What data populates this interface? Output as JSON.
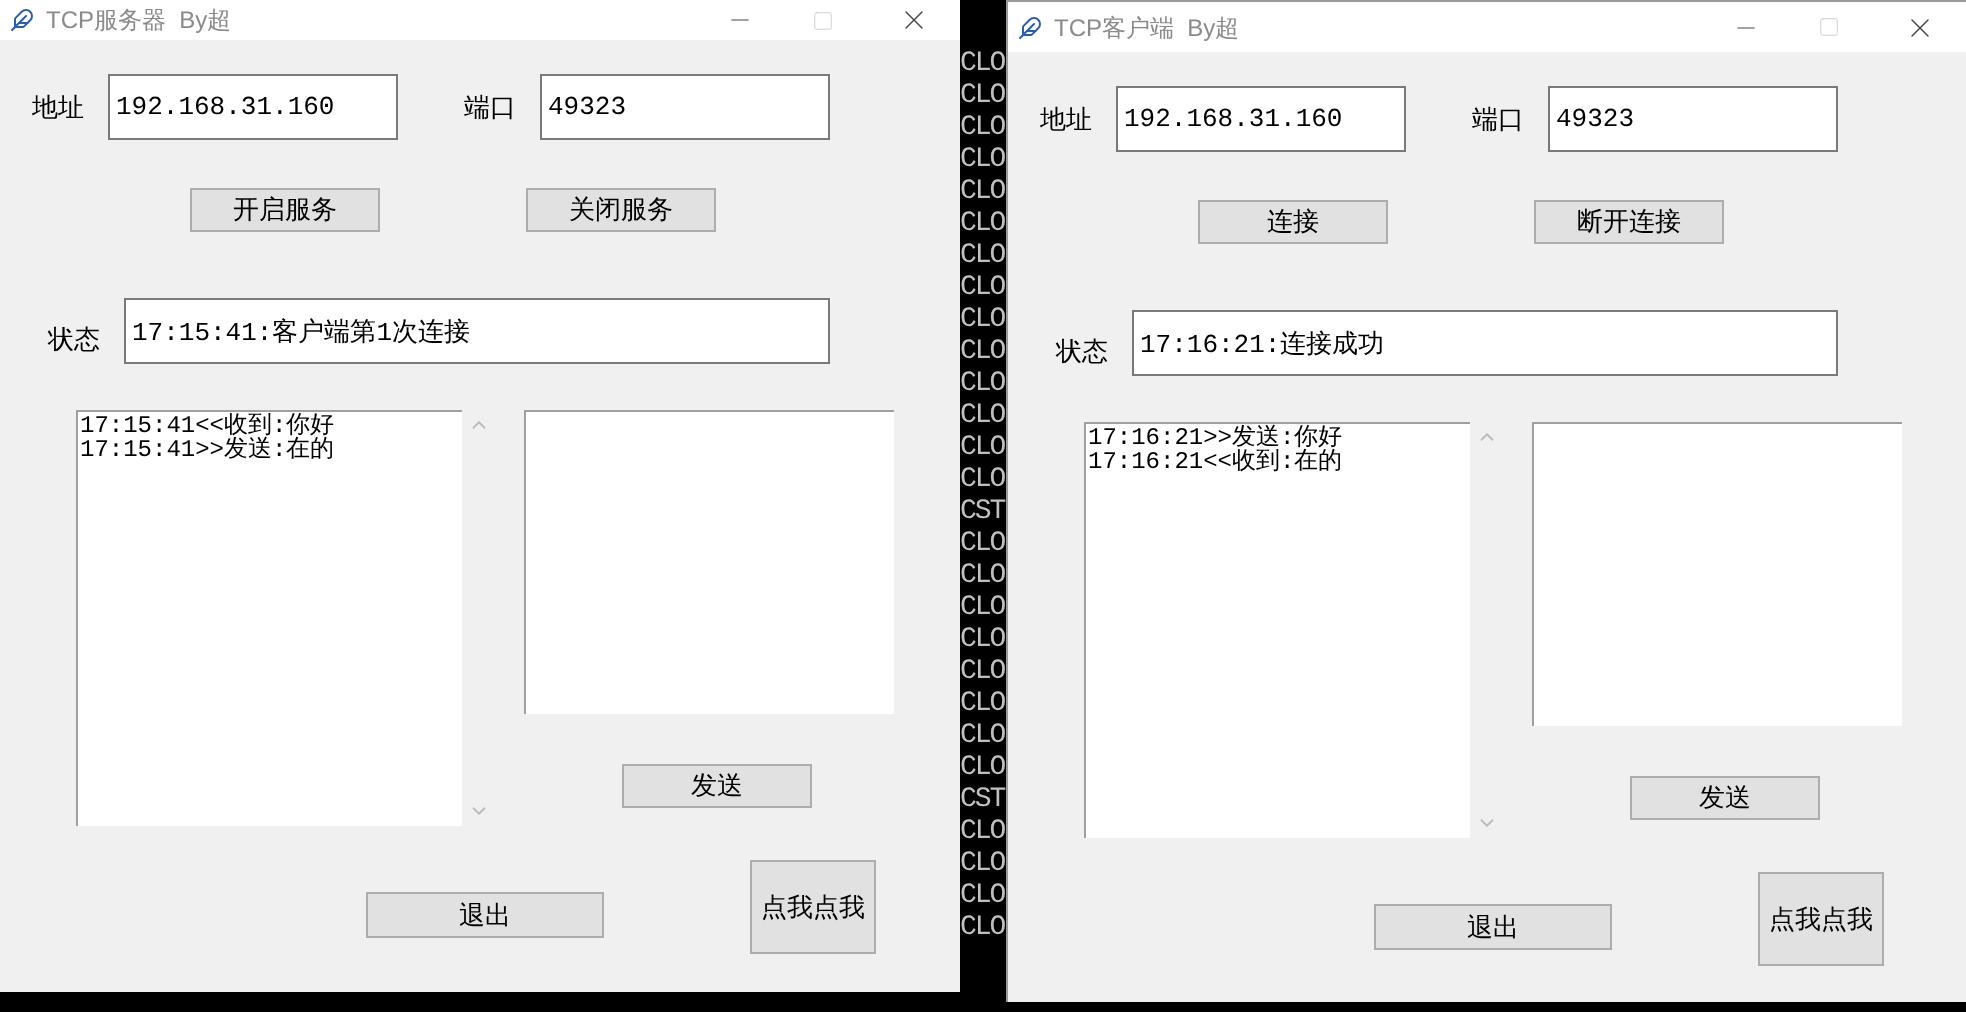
{
  "console": {
    "lines": [
      "CLO",
      "CLO",
      "CLO",
      "CLO",
      "CLO",
      "CLO",
      "CLO",
      "CLO",
      "CLO",
      "CLO",
      "CLO",
      "CLO",
      "CLO",
      "CLO",
      "CST",
      "CLO",
      "CLO",
      "CLO",
      "CLO",
      "CLO",
      "CLO",
      "CLO",
      "CLO",
      "CST",
      "CLO",
      "CLO",
      "CLO",
      "CLO"
    ]
  },
  "windows": [
    {
      "title": "TCP服务器  By超",
      "address_label": "地址",
      "address": "192.168.31.160",
      "port_label": "端口",
      "port": "49323",
      "buttons": [
        "开启服务",
        "关闭服务"
      ],
      "status_label": "状态",
      "status": "17:15:41:客户端第1次连接",
      "log": [
        "17:15:41<<收到:你好",
        "17:15:41>>发送:在的"
      ],
      "send_button": "发送",
      "exit_button": "退出",
      "click_button": "点我点我"
    },
    {
      "title": "TCP客户端  By超",
      "address_label": "地址",
      "address": "192.168.31.160",
      "port_label": "端口",
      "port": "49323",
      "buttons": [
        "连接",
        "断开连接"
      ],
      "status_label": "状态",
      "status": "17:16:21:连接成功",
      "log": [
        "17:16:21>>发送:你好",
        "17:16:21<<收到:在的"
      ],
      "send_button": "发送",
      "exit_button": "退出",
      "click_button": "点我点我"
    }
  ]
}
